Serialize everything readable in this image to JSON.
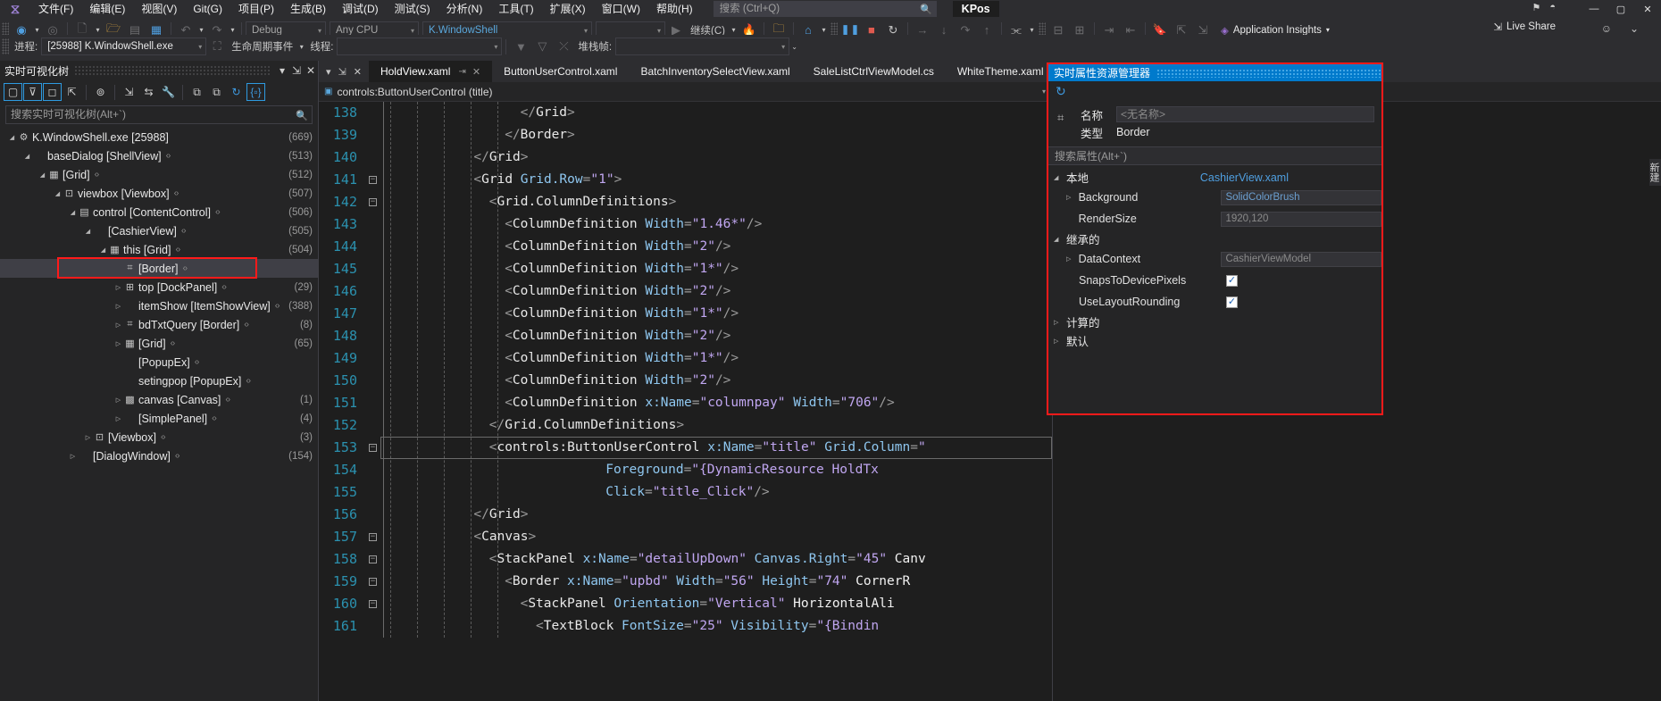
{
  "menubar": {
    "logo": "vs-logo-icon",
    "items": [
      "文件(F)",
      "编辑(E)",
      "视图(V)",
      "Git(G)",
      "项目(P)",
      "生成(B)",
      "调试(D)",
      "测试(S)",
      "分析(N)",
      "工具(T)",
      "扩展(X)",
      "窗口(W)",
      "帮助(H)"
    ],
    "search_placeholder": "搜索 (Ctrl+Q)",
    "app_badge": "KPos",
    "window_buttons": [
      "—",
      "▢",
      "✕"
    ]
  },
  "toolbar": {
    "config": "Debug",
    "platform": "Any CPU",
    "startup_project": "K.WindowShell",
    "continue_label": "继续(C)",
    "application_insights": "Application Insights",
    "live_share": "Live Share"
  },
  "toolbar2": {
    "process_label": "进程:",
    "process_value": "[25988] K.WindowShell.exe",
    "lifecycle_label": "生命周期事件",
    "thread_label": "线程:",
    "thread_value": "",
    "stackframe_label": "堆栈帧:",
    "stackframe_value": ""
  },
  "left_panel": {
    "title": "实时可视化树",
    "search_placeholder": "搜索实时可视化树(Alt+`)",
    "toolbar_icons": [
      "select-element-icon",
      "display-layout-icon",
      "preview-selection-icon",
      "track-focus-icon",
      "show-in-tree-icon",
      "highlight-icon",
      "swap-icon",
      "properties-wrench-icon",
      "copy-xaml-icon",
      "copy-tree-icon",
      "refresh-icon",
      "show-source-icon"
    ],
    "tree": [
      {
        "indent": 0,
        "twist": "▴",
        "icon": "process-icon",
        "label": "K.WindowShell.exe [25988]",
        "code": false,
        "count": "(669)"
      },
      {
        "indent": 1,
        "twist": "▴",
        "icon": "",
        "label": "baseDialog [ShellView]",
        "code": true,
        "count": "(513)"
      },
      {
        "indent": 2,
        "twist": "▴",
        "icon": "grid-icon",
        "label": "[Grid]",
        "code": true,
        "count": "(512)"
      },
      {
        "indent": 3,
        "twist": "▴",
        "icon": "viewbox-icon",
        "label": "viewbox [Viewbox]",
        "code": true,
        "count": "(507)"
      },
      {
        "indent": 4,
        "twist": "▴",
        "icon": "contentcontrol-icon",
        "label": "control [ContentControl]",
        "code": true,
        "count": "(506)"
      },
      {
        "indent": 5,
        "twist": "▴",
        "icon": "",
        "label": "[CashierView]",
        "code": true,
        "count": "(505)"
      },
      {
        "indent": 6,
        "twist": "▴",
        "icon": "grid-icon",
        "label": "this [Grid]",
        "code": true,
        "count": "(504)"
      },
      {
        "indent": 7,
        "twist": "",
        "icon": "border-icon",
        "label": "[Border]",
        "code": true,
        "count": "",
        "selected": true
      },
      {
        "indent": 7,
        "twist": "▸",
        "icon": "dockpanel-icon",
        "label": "top [DockPanel]",
        "code": true,
        "count": "(29)"
      },
      {
        "indent": 7,
        "twist": "▸",
        "icon": "",
        "label": "itemShow [ItemShowView]",
        "code": true,
        "count": "(388)"
      },
      {
        "indent": 7,
        "twist": "▸",
        "icon": "border-icon",
        "label": "bdTxtQuery [Border]",
        "code": true,
        "count": "(8)"
      },
      {
        "indent": 7,
        "twist": "▸",
        "icon": "grid-icon",
        "label": "[Grid]",
        "code": true,
        "count": "(65)"
      },
      {
        "indent": 7,
        "twist": "",
        "icon": "",
        "label": "[PopupEx]",
        "code": true,
        "count": ""
      },
      {
        "indent": 7,
        "twist": "",
        "icon": "",
        "label": "setingpop [PopupEx]",
        "code": true,
        "count": ""
      },
      {
        "indent": 7,
        "twist": "▸",
        "icon": "canvas-icon",
        "label": "canvas [Canvas]",
        "code": true,
        "count": "(1)"
      },
      {
        "indent": 7,
        "twist": "▸",
        "icon": "",
        "label": "[SimplePanel]",
        "code": true,
        "count": "(4)"
      },
      {
        "indent": 5,
        "twist": "▸",
        "icon": "viewbox-icon",
        "label": "[Viewbox]",
        "code": true,
        "count": "(3)"
      },
      {
        "indent": 4,
        "twist": "▸",
        "icon": "",
        "label": "[DialogWindow]",
        "code": true,
        "count": "(154)"
      }
    ]
  },
  "editor": {
    "tabs": [
      {
        "label": "HoldView.xaml",
        "active": true,
        "pin": "⇥",
        "close": "✕"
      },
      {
        "label": "ButtonUserControl.xaml",
        "active": false
      },
      {
        "label": "BatchInventorySelectView.xaml",
        "active": false
      },
      {
        "label": "SaleListCtrlViewModel.cs",
        "active": false
      },
      {
        "label": "WhiteTheme.xaml",
        "active": false
      }
    ],
    "breadcrumb_left": "controls:ButtonUserControl (title)",
    "breadcrumb_right": "controls:ButtonUserControl (title)",
    "lines": [
      {
        "n": "138",
        "fold": "",
        "indent": 18,
        "text": "</Grid>"
      },
      {
        "n": "139",
        "fold": "",
        "indent": 16,
        "text": "</Border>"
      },
      {
        "n": "140",
        "fold": "",
        "indent": 12,
        "text": "</Grid>"
      },
      {
        "n": "141",
        "fold": "minus",
        "indent": 12,
        "text": "<Grid Grid.Row=\"1\">"
      },
      {
        "n": "142",
        "fold": "minus",
        "indent": 14,
        "text": "<Grid.ColumnDefinitions>"
      },
      {
        "n": "143",
        "fold": "",
        "indent": 16,
        "text": "<ColumnDefinition Width=\"1.46*\"/>"
      },
      {
        "n": "144",
        "fold": "",
        "indent": 16,
        "text": "<ColumnDefinition Width=\"2\"/>"
      },
      {
        "n": "145",
        "fold": "",
        "indent": 16,
        "text": "<ColumnDefinition Width=\"1*\"/>"
      },
      {
        "n": "146",
        "fold": "",
        "indent": 16,
        "text": "<ColumnDefinition Width=\"2\"/>"
      },
      {
        "n": "147",
        "fold": "",
        "indent": 16,
        "text": "<ColumnDefinition Width=\"1*\"/>"
      },
      {
        "n": "148",
        "fold": "",
        "indent": 16,
        "text": "<ColumnDefinition Width=\"2\"/>"
      },
      {
        "n": "149",
        "fold": "",
        "indent": 16,
        "text": "<ColumnDefinition Width=\"1*\"/>"
      },
      {
        "n": "150",
        "fold": "",
        "indent": 16,
        "text": "<ColumnDefinition Width=\"2\"/>"
      },
      {
        "n": "151",
        "fold": "",
        "indent": 16,
        "text": "<ColumnDefinition x:Name=\"columnpay\" Width=\"706\"/>"
      },
      {
        "n": "152",
        "fold": "",
        "indent": 14,
        "text": "</Grid.ColumnDefinitions>"
      },
      {
        "n": "153",
        "fold": "minus",
        "indent": 14,
        "text": "<controls:ButtonUserControl x:Name=\"title\" Grid.Column=\"",
        "highlight": true
      },
      {
        "n": "154",
        "fold": "",
        "indent": 29,
        "text": "Foreground=\"{DynamicResource HoldTx"
      },
      {
        "n": "155",
        "fold": "",
        "indent": 29,
        "text": "Click=\"title_Click\"/>"
      },
      {
        "n": "156",
        "fold": "",
        "indent": 12,
        "text": "</Grid>"
      },
      {
        "n": "157",
        "fold": "minus",
        "indent": 12,
        "text": "<Canvas>"
      },
      {
        "n": "158",
        "fold": "minus",
        "indent": 14,
        "text": "<StackPanel x:Name=\"detailUpDown\" Canvas.Right=\"45\" Canv"
      },
      {
        "n": "159",
        "fold": "minus",
        "indent": 16,
        "text": "<Border x:Name=\"upbd\" Width=\"56\" Height=\"74\" CornerR"
      },
      {
        "n": "160",
        "fold": "minus",
        "indent": 18,
        "text": "<StackPanel Orientation=\"Vertical\" HorizontalAli"
      },
      {
        "n": "161",
        "fold": "",
        "indent": 20,
        "text": "<TextBlock FontSize=\"25\" Visibility=\"{Bindin"
      }
    ]
  },
  "property_panel": {
    "title": "实时属性资源管理器",
    "refresh_icon": "refresh-icon",
    "element_icon": "border-icon",
    "name_label": "名称",
    "name_value": "<无名称>",
    "type_label": "类型",
    "type_value": "Border",
    "search_placeholder": "搜索属性(Alt+`)",
    "groups": [
      {
        "twist": "▴",
        "label": "本地",
        "source": "CashierView.xaml",
        "rows": [
          {
            "twist": "▸",
            "name": "Background",
            "value": "SolidColorBrush",
            "kind": "field-link"
          },
          {
            "twist": "",
            "name": "RenderSize",
            "value": "1920,120",
            "kind": "field-plain"
          }
        ]
      },
      {
        "twist": "▴",
        "label": "继承的",
        "source": "",
        "rows": [
          {
            "twist": "▸",
            "name": "DataContext",
            "value": "CashierViewModel",
            "kind": "field-plain"
          },
          {
            "twist": "",
            "name": "SnapsToDevicePixels",
            "value": "✓",
            "kind": "check"
          },
          {
            "twist": "",
            "name": "UseLayoutRounding",
            "value": "✓",
            "kind": "check"
          }
        ]
      },
      {
        "twist": "▸",
        "label": "计算的",
        "source": "",
        "rows": []
      },
      {
        "twist": "▸",
        "label": "默认",
        "source": "",
        "rows": []
      }
    ]
  },
  "side_tab": {
    "label": "新建"
  },
  "colors": {
    "accent_blue": "#007acc",
    "highlight_red": "#ff1a1a",
    "panel_bg": "#252526",
    "editor_bg": "#1e1e1e",
    "chrome_bg": "#2d2d30"
  }
}
